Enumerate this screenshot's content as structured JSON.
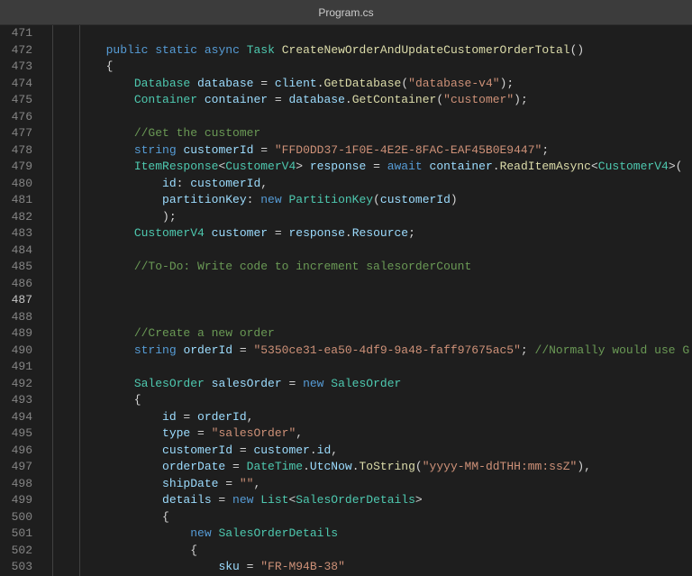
{
  "titlebar": {
    "filename": "Program.cs"
  },
  "lineStart": 471,
  "activeLine": 487,
  "lines": [
    {
      "n": 471,
      "tokens": []
    },
    {
      "n": 472,
      "tokens": [
        {
          "t": "  ",
          "c": ""
        },
        {
          "t": "public",
          "c": "kw-mod"
        },
        {
          "t": " ",
          "c": ""
        },
        {
          "t": "static",
          "c": "kw-mod"
        },
        {
          "t": " ",
          "c": ""
        },
        {
          "t": "async",
          "c": "kw-mod"
        },
        {
          "t": " ",
          "c": ""
        },
        {
          "t": "Task",
          "c": "cls"
        },
        {
          "t": " ",
          "c": ""
        },
        {
          "t": "CreateNewOrderAndUpdateCustomerOrderTotal",
          "c": "method"
        },
        {
          "t": "()",
          "c": "punct"
        }
      ]
    },
    {
      "n": 473,
      "tokens": [
        {
          "t": "  {",
          "c": "punct"
        }
      ]
    },
    {
      "n": 474,
      "tokens": [
        {
          "t": "      ",
          "c": ""
        },
        {
          "t": "Database",
          "c": "cls"
        },
        {
          "t": " ",
          "c": ""
        },
        {
          "t": "database",
          "c": "var"
        },
        {
          "t": " = ",
          "c": "punct"
        },
        {
          "t": "client",
          "c": "var"
        },
        {
          "t": ".",
          "c": "punct"
        },
        {
          "t": "GetDatabase",
          "c": "method"
        },
        {
          "t": "(",
          "c": "punct"
        },
        {
          "t": "\"database-v4\"",
          "c": "str"
        },
        {
          "t": ");",
          "c": "punct"
        }
      ]
    },
    {
      "n": 475,
      "tokens": [
        {
          "t": "      ",
          "c": ""
        },
        {
          "t": "Container",
          "c": "cls"
        },
        {
          "t": " ",
          "c": ""
        },
        {
          "t": "container",
          "c": "var"
        },
        {
          "t": " = ",
          "c": "punct"
        },
        {
          "t": "database",
          "c": "var"
        },
        {
          "t": ".",
          "c": "punct"
        },
        {
          "t": "GetContainer",
          "c": "method"
        },
        {
          "t": "(",
          "c": "punct"
        },
        {
          "t": "\"customer\"",
          "c": "str"
        },
        {
          "t": ");",
          "c": "punct"
        }
      ]
    },
    {
      "n": 476,
      "tokens": []
    },
    {
      "n": 477,
      "tokens": [
        {
          "t": "      ",
          "c": ""
        },
        {
          "t": "//Get the customer",
          "c": "cmt"
        }
      ]
    },
    {
      "n": 478,
      "tokens": [
        {
          "t": "      ",
          "c": ""
        },
        {
          "t": "string",
          "c": "kw-type"
        },
        {
          "t": " ",
          "c": ""
        },
        {
          "t": "customerId",
          "c": "var"
        },
        {
          "t": " = ",
          "c": "punct"
        },
        {
          "t": "\"FFD0DD37-1F0E-4E2E-8FAC-EAF45B0E9447\"",
          "c": "str"
        },
        {
          "t": ";",
          "c": "punct"
        }
      ]
    },
    {
      "n": 479,
      "tokens": [
        {
          "t": "      ",
          "c": ""
        },
        {
          "t": "ItemResponse",
          "c": "cls"
        },
        {
          "t": "<",
          "c": "punct"
        },
        {
          "t": "CustomerV4",
          "c": "cls"
        },
        {
          "t": "> ",
          "c": "punct"
        },
        {
          "t": "response",
          "c": "var"
        },
        {
          "t": " = ",
          "c": "punct"
        },
        {
          "t": "await",
          "c": "kw-mod"
        },
        {
          "t": " ",
          "c": ""
        },
        {
          "t": "container",
          "c": "var"
        },
        {
          "t": ".",
          "c": "punct"
        },
        {
          "t": "ReadItemAsync",
          "c": "method"
        },
        {
          "t": "<",
          "c": "punct"
        },
        {
          "t": "CustomerV4",
          "c": "cls"
        },
        {
          "t": ">(",
          "c": "punct"
        }
      ]
    },
    {
      "n": 480,
      "tokens": [
        {
          "t": "          ",
          "c": ""
        },
        {
          "t": "id",
          "c": "var"
        },
        {
          "t": ": ",
          "c": "punct"
        },
        {
          "t": "customerId",
          "c": "var"
        },
        {
          "t": ",",
          "c": "punct"
        }
      ]
    },
    {
      "n": 481,
      "tokens": [
        {
          "t": "          ",
          "c": ""
        },
        {
          "t": "partitionKey",
          "c": "var"
        },
        {
          "t": ": ",
          "c": "punct"
        },
        {
          "t": "new",
          "c": "kw-mod"
        },
        {
          "t": " ",
          "c": ""
        },
        {
          "t": "PartitionKey",
          "c": "cls"
        },
        {
          "t": "(",
          "c": "punct"
        },
        {
          "t": "customerId",
          "c": "var"
        },
        {
          "t": ")",
          "c": "punct"
        }
      ]
    },
    {
      "n": 482,
      "tokens": [
        {
          "t": "          );",
          "c": "punct"
        }
      ]
    },
    {
      "n": 483,
      "tokens": [
        {
          "t": "      ",
          "c": ""
        },
        {
          "t": "CustomerV4",
          "c": "cls"
        },
        {
          "t": " ",
          "c": ""
        },
        {
          "t": "customer",
          "c": "var"
        },
        {
          "t": " = ",
          "c": "punct"
        },
        {
          "t": "response",
          "c": "var"
        },
        {
          "t": ".",
          "c": "punct"
        },
        {
          "t": "Resource",
          "c": "prop"
        },
        {
          "t": ";",
          "c": "punct"
        }
      ]
    },
    {
      "n": 484,
      "tokens": []
    },
    {
      "n": 485,
      "tokens": [
        {
          "t": "      ",
          "c": ""
        },
        {
          "t": "//To-Do: Write code to increment salesorderCount",
          "c": "cmt"
        }
      ]
    },
    {
      "n": 486,
      "tokens": []
    },
    {
      "n": 487,
      "tokens": []
    },
    {
      "n": 488,
      "tokens": []
    },
    {
      "n": 489,
      "tokens": [
        {
          "t": "      ",
          "c": ""
        },
        {
          "t": "//Create a new order",
          "c": "cmt"
        }
      ]
    },
    {
      "n": 490,
      "tokens": [
        {
          "t": "      ",
          "c": ""
        },
        {
          "t": "string",
          "c": "kw-type"
        },
        {
          "t": " ",
          "c": ""
        },
        {
          "t": "orderId",
          "c": "var"
        },
        {
          "t": " = ",
          "c": "punct"
        },
        {
          "t": "\"5350ce31-ea50-4df9-9a48-faff97675ac5\"",
          "c": "str"
        },
        {
          "t": "; ",
          "c": "punct"
        },
        {
          "t": "//Normally would use G",
          "c": "cmt"
        }
      ]
    },
    {
      "n": 491,
      "tokens": []
    },
    {
      "n": 492,
      "tokens": [
        {
          "t": "      ",
          "c": ""
        },
        {
          "t": "SalesOrder",
          "c": "cls"
        },
        {
          "t": " ",
          "c": ""
        },
        {
          "t": "salesOrder",
          "c": "var"
        },
        {
          "t": " = ",
          "c": "punct"
        },
        {
          "t": "new",
          "c": "kw-mod"
        },
        {
          "t": " ",
          "c": ""
        },
        {
          "t": "SalesOrder",
          "c": "cls"
        }
      ]
    },
    {
      "n": 493,
      "tokens": [
        {
          "t": "      {",
          "c": "punct"
        }
      ]
    },
    {
      "n": 494,
      "tokens": [
        {
          "t": "          ",
          "c": ""
        },
        {
          "t": "id",
          "c": "prop"
        },
        {
          "t": " = ",
          "c": "punct"
        },
        {
          "t": "orderId",
          "c": "var"
        },
        {
          "t": ",",
          "c": "punct"
        }
      ]
    },
    {
      "n": 495,
      "tokens": [
        {
          "t": "          ",
          "c": ""
        },
        {
          "t": "type",
          "c": "prop"
        },
        {
          "t": " = ",
          "c": "punct"
        },
        {
          "t": "\"salesOrder\"",
          "c": "str"
        },
        {
          "t": ",",
          "c": "punct"
        }
      ]
    },
    {
      "n": 496,
      "tokens": [
        {
          "t": "          ",
          "c": ""
        },
        {
          "t": "customerId",
          "c": "prop"
        },
        {
          "t": " = ",
          "c": "punct"
        },
        {
          "t": "customer",
          "c": "var"
        },
        {
          "t": ".",
          "c": "punct"
        },
        {
          "t": "id",
          "c": "prop"
        },
        {
          "t": ",",
          "c": "punct"
        }
      ]
    },
    {
      "n": 497,
      "tokens": [
        {
          "t": "          ",
          "c": ""
        },
        {
          "t": "orderDate",
          "c": "prop"
        },
        {
          "t": " = ",
          "c": "punct"
        },
        {
          "t": "DateTime",
          "c": "cls"
        },
        {
          "t": ".",
          "c": "punct"
        },
        {
          "t": "UtcNow",
          "c": "prop"
        },
        {
          "t": ".",
          "c": "punct"
        },
        {
          "t": "ToString",
          "c": "method"
        },
        {
          "t": "(",
          "c": "punct"
        },
        {
          "t": "\"yyyy-MM-ddTHH:mm:ssZ\"",
          "c": "str"
        },
        {
          "t": "),",
          "c": "punct"
        }
      ]
    },
    {
      "n": 498,
      "tokens": [
        {
          "t": "          ",
          "c": ""
        },
        {
          "t": "shipDate",
          "c": "prop"
        },
        {
          "t": " = ",
          "c": "punct"
        },
        {
          "t": "\"\"",
          "c": "str"
        },
        {
          "t": ",",
          "c": "punct"
        }
      ]
    },
    {
      "n": 499,
      "tokens": [
        {
          "t": "          ",
          "c": ""
        },
        {
          "t": "details",
          "c": "prop"
        },
        {
          "t": " = ",
          "c": "punct"
        },
        {
          "t": "new",
          "c": "kw-mod"
        },
        {
          "t": " ",
          "c": ""
        },
        {
          "t": "List",
          "c": "cls"
        },
        {
          "t": "<",
          "c": "punct"
        },
        {
          "t": "SalesOrderDetails",
          "c": "cls"
        },
        {
          "t": ">",
          "c": "punct"
        }
      ]
    },
    {
      "n": 500,
      "tokens": [
        {
          "t": "          {",
          "c": "punct"
        }
      ]
    },
    {
      "n": 501,
      "tokens": [
        {
          "t": "              ",
          "c": ""
        },
        {
          "t": "new",
          "c": "kw-mod"
        },
        {
          "t": " ",
          "c": ""
        },
        {
          "t": "SalesOrderDetails",
          "c": "cls"
        }
      ]
    },
    {
      "n": 502,
      "tokens": [
        {
          "t": "              {",
          "c": "punct"
        }
      ]
    },
    {
      "n": 503,
      "tokens": [
        {
          "t": "                  ",
          "c": ""
        },
        {
          "t": "sku",
          "c": "prop"
        },
        {
          "t": " = ",
          "c": "punct"
        },
        {
          "t": "\"FR-M94B-38\"",
          "c": "str"
        }
      ]
    }
  ]
}
